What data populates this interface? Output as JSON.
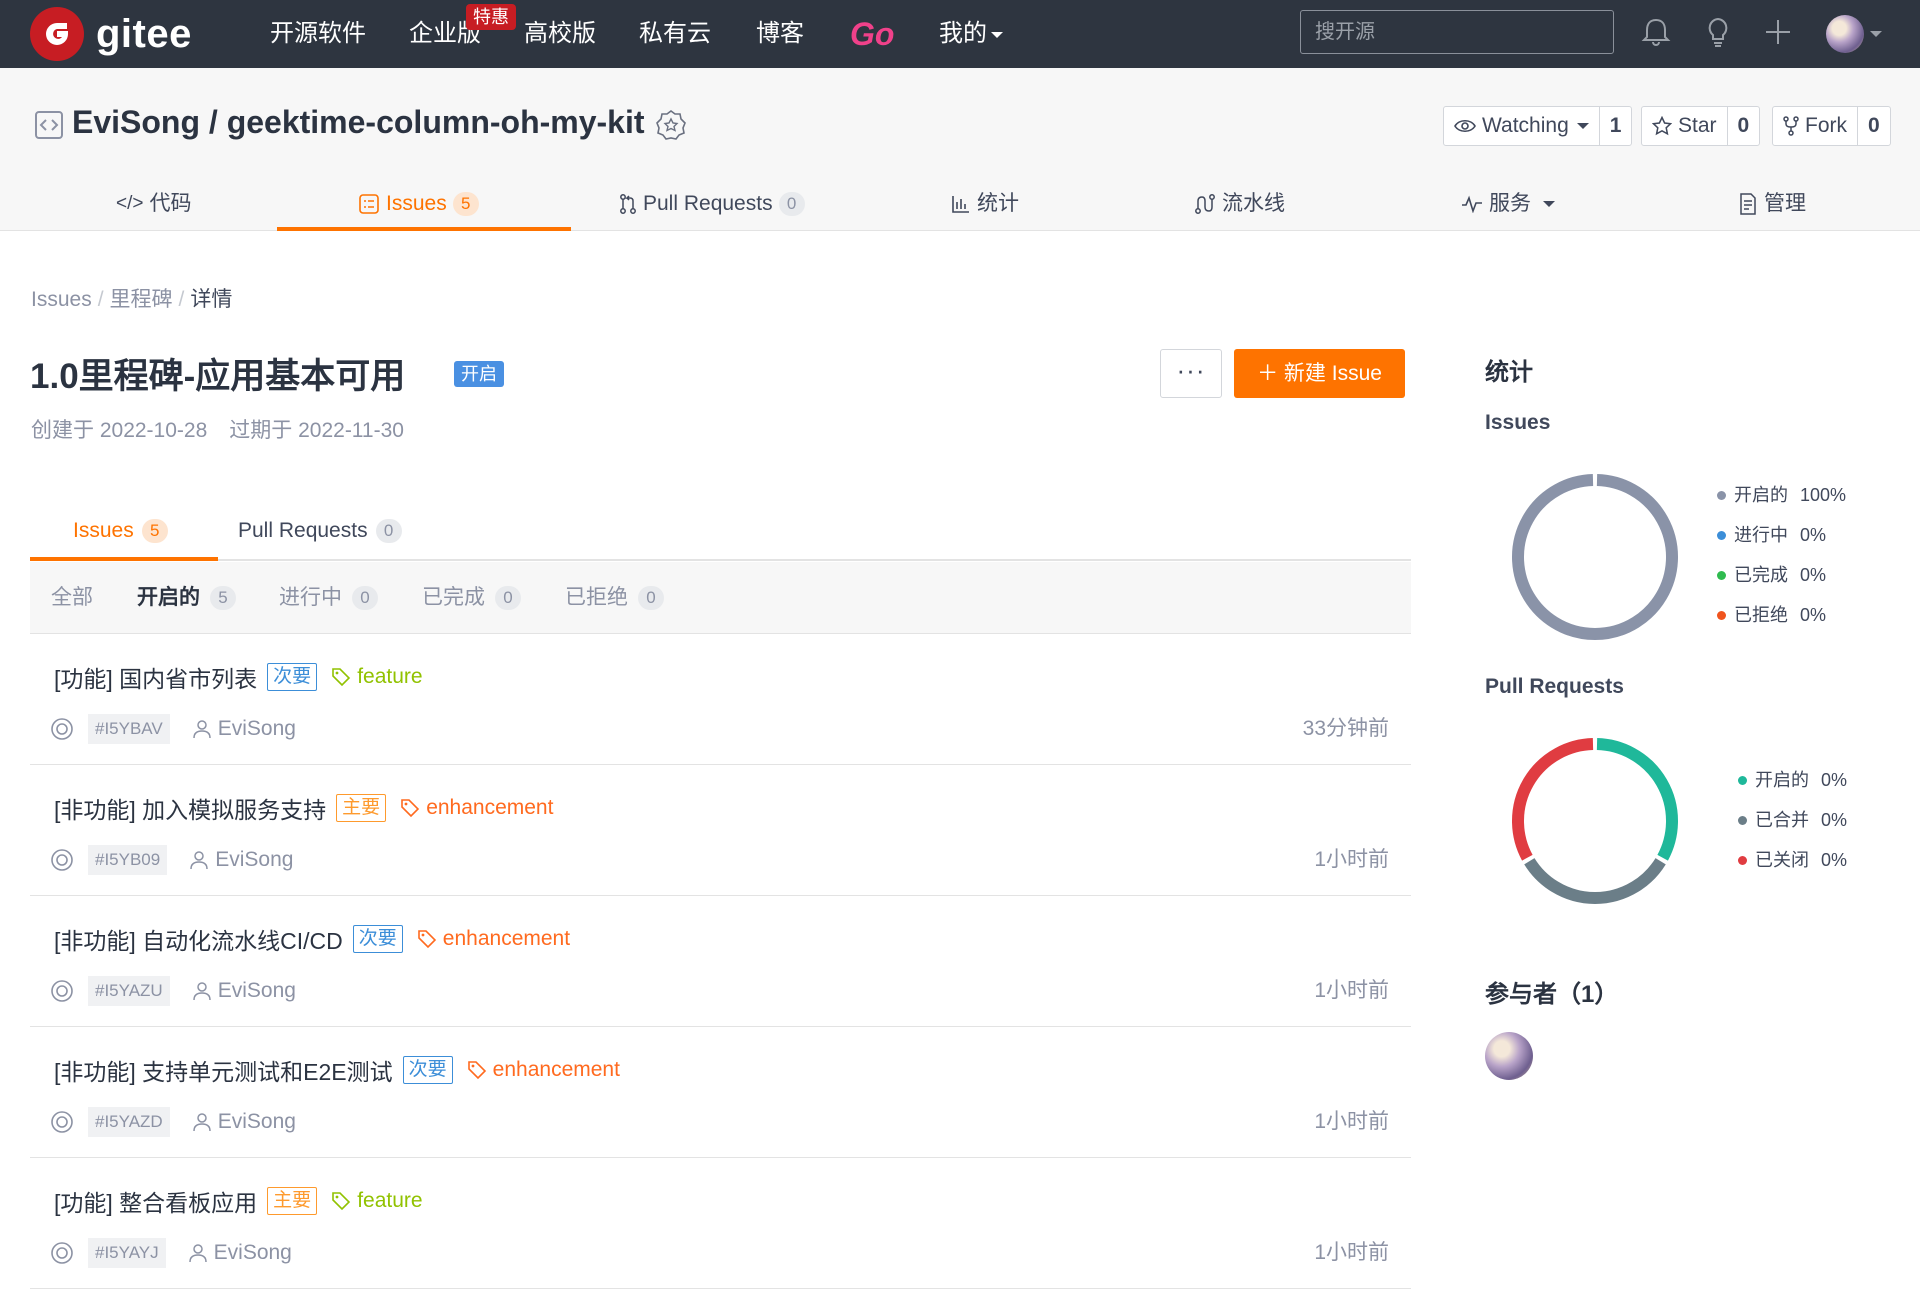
{
  "topnav": {
    "logo_text": "gitee",
    "items": [
      {
        "label": "开源软件"
      },
      {
        "label": "企业版",
        "badge": "特惠"
      },
      {
        "label": "高校版"
      },
      {
        "label": "私有云"
      },
      {
        "label": "博客"
      },
      {
        "label": "Go"
      },
      {
        "label": "我的"
      }
    ],
    "search_placeholder": "搜开源",
    "icons": [
      "bell-icon",
      "lightbulb-icon",
      "plus-icon"
    ]
  },
  "repo": {
    "title": "EviSong / geektime-column-oh-my-kit",
    "watch": {
      "label": "Watching",
      "count": "1"
    },
    "star": {
      "label": "Star",
      "count": "0"
    },
    "fork": {
      "label": "Fork",
      "count": "0"
    },
    "tabs": [
      {
        "label": "代码"
      },
      {
        "label": "Issues",
        "count": "5"
      },
      {
        "label": "Pull Requests",
        "count": "0"
      },
      {
        "label": "统计"
      },
      {
        "label": "流水线"
      },
      {
        "label": "服务"
      },
      {
        "label": "管理"
      }
    ]
  },
  "breadcrumb": {
    "items": [
      "Issues",
      "里程碑",
      "详情"
    ]
  },
  "milestone": {
    "title": "1.0里程碑-应用基本可用",
    "state": "开启",
    "created": "创建于 2022-10-28",
    "due": "过期于 2022-11-30",
    "more_label": "···",
    "new_issue_label": "＋ 新建 Issue"
  },
  "subtabs": [
    {
      "label": "Issues",
      "count": "5"
    },
    {
      "label": "Pull Requests",
      "count": "0"
    }
  ],
  "filters": [
    {
      "label": "全部",
      "count": ""
    },
    {
      "label": "开启的",
      "count": "5"
    },
    {
      "label": "进行中",
      "count": "0"
    },
    {
      "label": "已完成",
      "count": "0"
    },
    {
      "label": "已拒绝",
      "count": "0"
    }
  ],
  "issues": [
    {
      "title": "[功能] 国内省市列表",
      "priority": "次要",
      "priority_type": "minor",
      "label": "feature",
      "label_type": "feature",
      "ident": "#I5YBAV",
      "author": "EviSong",
      "time": "33分钟前"
    },
    {
      "title": "[非功能] 加入模拟服务支持",
      "priority": "主要",
      "priority_type": "major",
      "label": "enhancement",
      "label_type": "enhancement",
      "ident": "#I5YB09",
      "author": "EviSong",
      "time": "1小时前"
    },
    {
      "title": "[非功能] 自动化流水线CI/CD",
      "priority": "次要",
      "priority_type": "minor",
      "label": "enhancement",
      "label_type": "enhancement",
      "ident": "#I5YAZU",
      "author": "EviSong",
      "time": "1小时前"
    },
    {
      "title": "[非功能] 支持单元测试和E2E测试",
      "priority": "次要",
      "priority_type": "minor",
      "label": "enhancement",
      "label_type": "enhancement",
      "ident": "#I5YAZD",
      "author": "EviSong",
      "time": "1小时前"
    },
    {
      "title": "[功能] 整合看板应用",
      "priority": "主要",
      "priority_type": "major",
      "label": "feature",
      "label_type": "feature",
      "ident": "#I5YAYJ",
      "author": "EviSong",
      "time": "1小时前"
    }
  ],
  "sidebar": {
    "title": "统计",
    "issues_title": "Issues",
    "issues_legend": [
      {
        "label": "开启的",
        "pct": "100%",
        "color": "#8a93a8"
      },
      {
        "label": "进行中",
        "pct": "0%",
        "color": "#3c8ed8"
      },
      {
        "label": "已完成",
        "pct": "0%",
        "color": "#2fbb4f"
      },
      {
        "label": "已拒绝",
        "pct": "0%",
        "color": "#f0541e"
      }
    ],
    "pr_title": "Pull Requests",
    "pr_legend": [
      {
        "label": "开启的",
        "pct": "0%",
        "color": "#1fb89a"
      },
      {
        "label": "已合并",
        "pct": "0%",
        "color": "#6b7e88"
      },
      {
        "label": "已关闭",
        "pct": "0%",
        "color": "#e03c41"
      }
    ],
    "participants": "参与者（1）"
  },
  "chart_data": [
    {
      "type": "pie",
      "categories": [
        "开启的",
        "进行中",
        "已完成",
        "已拒绝"
      ],
      "values": [
        100,
        0,
        0,
        0
      ]
    },
    {
      "type": "pie",
      "categories": [
        "开启的",
        "已合并",
        "已关闭"
      ],
      "values": [
        33.3,
        33.3,
        33.3
      ]
    }
  ]
}
